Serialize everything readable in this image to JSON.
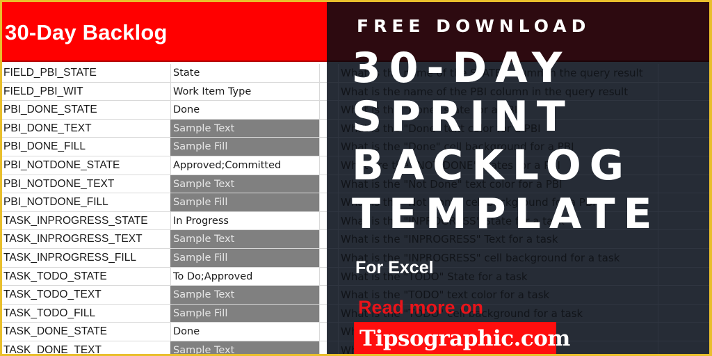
{
  "spreadsheet": {
    "title": "30-Day Backlog",
    "rows": [
      {
        "key": "FIELD_PBI_STATE",
        "value": "State",
        "sample": false,
        "description": "What is the name of the STATE column in the query result"
      },
      {
        "key": "FIELD_PBI_WIT",
        "value": "Work Item Type",
        "sample": false,
        "description": "What is the name of the PBI column in the query result"
      },
      {
        "key": "PBI_DONE_STATE",
        "value": "Done",
        "sample": false,
        "description": "What is the \"Done\" state for a PBI"
      },
      {
        "key": "PBI_DONE_TEXT",
        "value": "Sample Text",
        "sample": true,
        "description": "What is the \"Done\" text color for a PBI"
      },
      {
        "key": "PBI_DONE_FILL",
        "value": "Sample Fill",
        "sample": true,
        "description": "What is the \"Done\" cell background for a PBI"
      },
      {
        "key": "PBI_NOTDONE_STATE",
        "value": "Approved;Committed",
        "sample": false,
        "description": "What are the \"NOT DONE\" states for a PBI"
      },
      {
        "key": "PBI_NOTDONE_TEXT",
        "value": "Sample Text",
        "sample": true,
        "description": "What is the \"Not Done\" text color for a PBI"
      },
      {
        "key": "PBI_NOTDONE_FILL",
        "value": "Sample Fill",
        "sample": true,
        "description": "What is the \"Not Done\" cell background for a PBI"
      },
      {
        "key": "TASK_INPROGRESS_STATE",
        "value": "In Progress",
        "sample": false,
        "description": "What is the \"INPROGRESS\" State for a task"
      },
      {
        "key": "TASK_INPROGRESS_TEXT",
        "value": "Sample Text",
        "sample": true,
        "description": "What is the \"INPROGRESS\" Text for a task"
      },
      {
        "key": "TASK_INPROGRESS_FILL",
        "value": "Sample Fill",
        "sample": true,
        "description": "What is the \"INPROGRESS\" cell background for a task"
      },
      {
        "key": "TASK_TODO_STATE",
        "value": "To Do;Approved",
        "sample": false,
        "description": "What is the \"TODO\" State for a task"
      },
      {
        "key": "TASK_TODO_TEXT",
        "value": "Sample Text",
        "sample": true,
        "description": "What is the \"TODO\" text color for a task"
      },
      {
        "key": "TASK_TODO_FILL",
        "value": "Sample Fill",
        "sample": true,
        "description": "What is the \"TODO\" cell background for a task"
      },
      {
        "key": "TASK_DONE_STATE",
        "value": "Done",
        "sample": false,
        "description": "Wh"
      },
      {
        "key": "TASK_DONE_TEXT",
        "value": "Sample Text",
        "sample": true,
        "description": "Wh"
      }
    ]
  },
  "promo": {
    "kicker": "FREE DOWNLOAD",
    "title_lines": [
      "30-DAY",
      "SPRINT",
      "BACKLOG",
      "TEMPLATE"
    ],
    "subtitle": "For Excel",
    "read_more": "Read more on",
    "site": "Tipsographic.com"
  },
  "colors": {
    "header_red": "#ff0000",
    "sample_fill": "#808080",
    "overlay_dark": "#262c36",
    "overlay_top": "#2d0a10",
    "frame_gold": "#e9bf2c",
    "site_red": "#ff0e0e"
  }
}
